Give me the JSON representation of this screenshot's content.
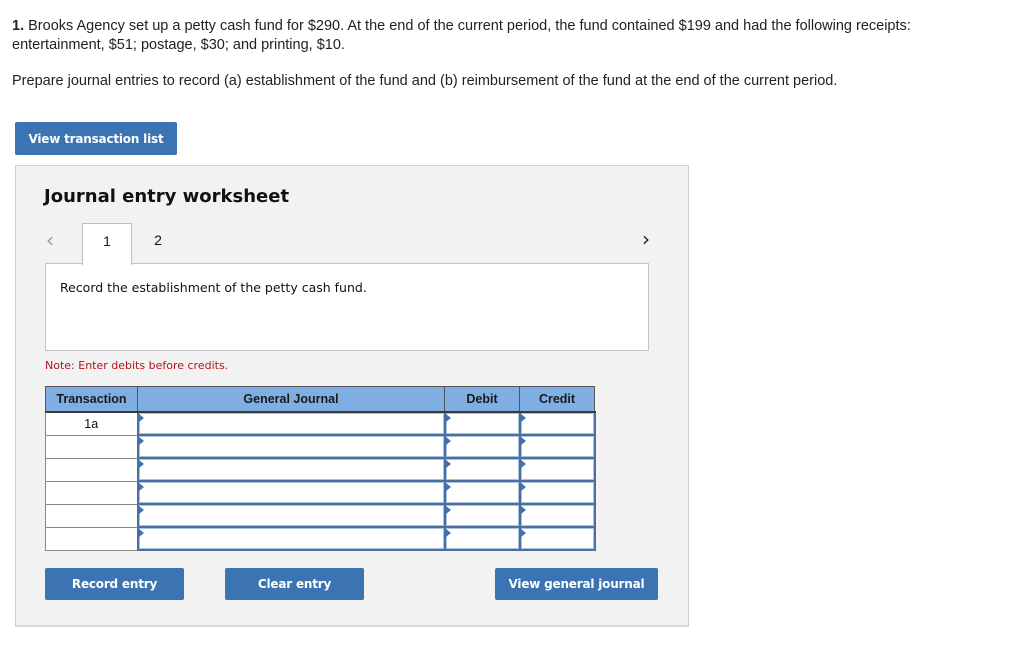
{
  "question": {
    "number": "1.",
    "text": "Brooks Agency set up a petty cash fund for $290. At the end of the current period, the fund contained $199 and had the following receipts: entertainment, $51; postage, $30; and printing, $10.",
    "instruction": "Prepare journal entries to record (a) establishment of the fund and (b) reimbursement of the fund at the end of the current period."
  },
  "buttons": {
    "view_transaction_list": "View transaction list",
    "record_entry": "Record entry",
    "clear_entry": "Clear entry",
    "view_general_journal": "View general journal"
  },
  "worksheet": {
    "title": "Journal entry worksheet",
    "nav_prev_icon": "chevron-left-icon",
    "nav_next_icon": "chevron-right-icon",
    "tabs": [
      {
        "label": "1",
        "active": true
      },
      {
        "label": "2",
        "active": false
      }
    ],
    "prompt": "Record the establishment of the petty cash fund.",
    "note": "Note: Enter debits before credits.",
    "table": {
      "headers": [
        "Transaction",
        "General Journal",
        "Debit",
        "Credit"
      ],
      "rows": [
        {
          "transaction": "1a",
          "account": "",
          "debit": "",
          "credit": ""
        },
        {
          "transaction": "",
          "account": "",
          "debit": "",
          "credit": ""
        },
        {
          "transaction": "",
          "account": "",
          "debit": "",
          "credit": ""
        },
        {
          "transaction": "",
          "account": "",
          "debit": "",
          "credit": ""
        },
        {
          "transaction": "",
          "account": "",
          "debit": "",
          "credit": ""
        },
        {
          "transaction": "",
          "account": "",
          "debit": "",
          "credit": ""
        }
      ]
    }
  },
  "colors": {
    "button_bg": "#3b73b3",
    "header_bg": "#7eaee2",
    "note_text": "#b0151f",
    "panel_bg": "#f2f2f2"
  }
}
